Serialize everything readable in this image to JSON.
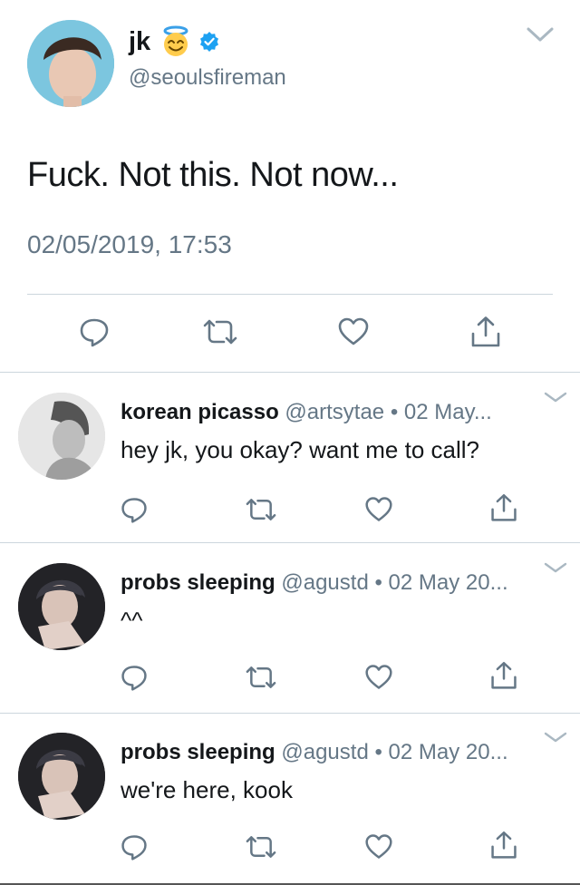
{
  "main_tweet": {
    "name": "jk",
    "handle": "@seoulsfireman",
    "emoji": "smiling-face-with-halo",
    "verified": true,
    "text": "Fuck. Not this. Not now...",
    "timestamp": "02/05/2019, 17:53"
  },
  "replies": [
    {
      "name": "korean picasso",
      "meta": "@artsytae • 02 May...",
      "text": "hey jk, you okay? want me to call?"
    },
    {
      "name": "probs sleeping",
      "meta": "@agustd • 02 May 20...",
      "text": "^^"
    },
    {
      "name": "probs sleeping",
      "meta": "@agustd • 02 May 20...",
      "text": "we're here, kook"
    }
  ],
  "colors": {
    "text": "#14171a",
    "secondary": "#657786",
    "divider": "#ccd6dd",
    "verified": "#1da1f2"
  },
  "icons": [
    "reply-icon",
    "retweet-icon",
    "like-icon",
    "share-icon",
    "chevron-down-icon",
    "verified-badge-icon"
  ]
}
